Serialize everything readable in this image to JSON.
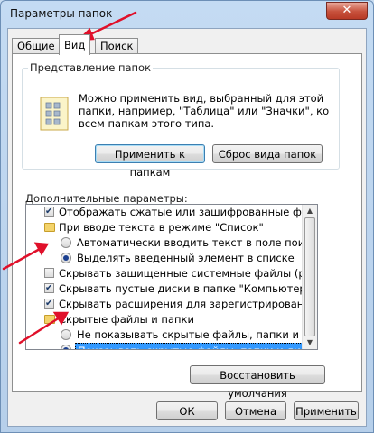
{
  "window": {
    "title": "Параметры папок",
    "close_glyph": "✕"
  },
  "tabs": [
    {
      "label": "Общие"
    },
    {
      "label": "Вид",
      "active": true
    },
    {
      "label": "Поиск"
    }
  ],
  "folder_view": {
    "legend": "Представление папок",
    "description": "Можно применить вид, выбранный для этой папки, например, \"Таблица\" или \"Значки\", ко всем папкам этого типа.",
    "apply_button": "Применить к папкам",
    "reset_button": "Сброс вида папок"
  },
  "advanced": {
    "label": "Дополнительные параметры:",
    "items": [
      {
        "type": "checkbox",
        "checked": true,
        "indent": 1,
        "label": "Отображать сжатые или зашифрованные файлы NTI"
      },
      {
        "type": "folder",
        "indent": 1,
        "label": "При вводе текста в режиме \"Список\""
      },
      {
        "type": "radio",
        "checked": false,
        "indent": 2,
        "label": "Автоматически вводить текст в поле поиска"
      },
      {
        "type": "radio",
        "checked": true,
        "indent": 2,
        "label": "Выделять введенный элемент в списке"
      },
      {
        "type": "checkbox",
        "checked": false,
        "indent": 1,
        "label": "Скрывать защищенные системные файлы (рекомен"
      },
      {
        "type": "checkbox",
        "checked": true,
        "indent": 1,
        "label": "Скрывать пустые диски в папке \"Компьютер\""
      },
      {
        "type": "checkbox",
        "checked": true,
        "indent": 1,
        "label": "Скрывать расширения для зарегистрированных типо"
      },
      {
        "type": "folder",
        "indent": 1,
        "label": "Скрытые файлы и папки"
      },
      {
        "type": "radio",
        "checked": false,
        "indent": 2,
        "label": "Не показывать скрытые файлы, папки и диски"
      },
      {
        "type": "radio",
        "checked": true,
        "indent": 2,
        "label": "Показывать скрытые файлы, папки и диски",
        "selected": true
      }
    ],
    "restore_button": "Восстановить умолчания"
  },
  "footer": {
    "ok": "ОК",
    "cancel": "Отмена",
    "apply": "Применить"
  },
  "colors": {
    "annotation_arrow": "#e0102a",
    "selection": "#3399ff"
  }
}
